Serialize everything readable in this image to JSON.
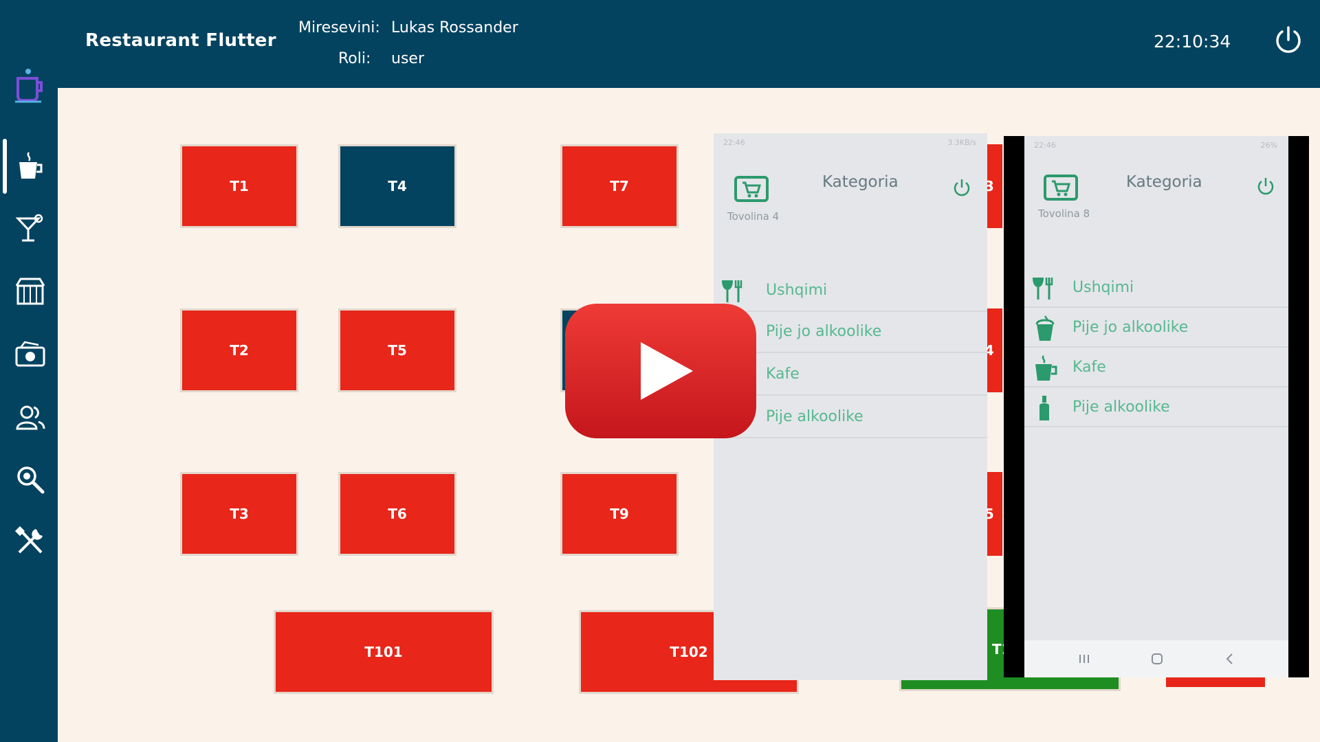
{
  "header": {
    "app_title": "Restaurant Flutter",
    "welcome_label": "Miresevini:",
    "user_name": "Lukas Rossander",
    "role_label": "Roli:",
    "role_value": "user",
    "clock": "22:10:34"
  },
  "sidebar": {
    "items": [
      {
        "icon": "coffee-cup-icon"
      },
      {
        "icon": "cocktail-icon"
      },
      {
        "icon": "store-icon"
      },
      {
        "icon": "cash-icon"
      },
      {
        "icon": "users-icon"
      },
      {
        "icon": "search-icon"
      },
      {
        "icon": "tools-icon"
      }
    ]
  },
  "tables": [
    {
      "label": "T1",
      "color": "#e8261a"
    },
    {
      "label": "T4",
      "color": "#044360"
    },
    {
      "label": "T7",
      "color": "#e8261a"
    },
    {
      "label": "T2",
      "color": "#e8261a"
    },
    {
      "label": "T5",
      "color": "#e8261a"
    },
    {
      "label": "T3",
      "color": "#e8261a"
    },
    {
      "label": "T6",
      "color": "#e8261a"
    },
    {
      "label": "T9",
      "color": "#e8261a"
    },
    {
      "label": "T101",
      "color": "#e8261a"
    },
    {
      "label": "T102",
      "color": "#e8261a"
    },
    {
      "label": "13",
      "color": "#e8261a"
    },
    {
      "label": "14",
      "color": "#e8261a"
    },
    {
      "label": "15",
      "color": "#e8261a"
    },
    {
      "label": "T1",
      "color": "#1e8e22"
    }
  ],
  "phone_left": {
    "status_time": "22:46",
    "status_right": "3.3KB/s",
    "title": "Kategoria",
    "subtitle": "Tovolina 4",
    "categories": [
      "Ushqimi",
      "Pije jo alkoolike",
      "Kafe",
      "Pije alkoolike"
    ]
  },
  "phone_right": {
    "status_time": "22:46",
    "status_right": "26%",
    "title": "Kategoria",
    "subtitle": "Tovolina 8",
    "categories": [
      "Ushqimi",
      "Pije jo alkoolike",
      "Kafe",
      "Pije alkoolike"
    ],
    "nav": [
      "recent-apps-icon",
      "home-icon",
      "back-icon"
    ]
  },
  "colors": {
    "primary": "#044360",
    "table_red": "#e8261a",
    "table_green": "#1e8e22",
    "accent_green": "#56b890",
    "play_red": "#e52a27"
  }
}
